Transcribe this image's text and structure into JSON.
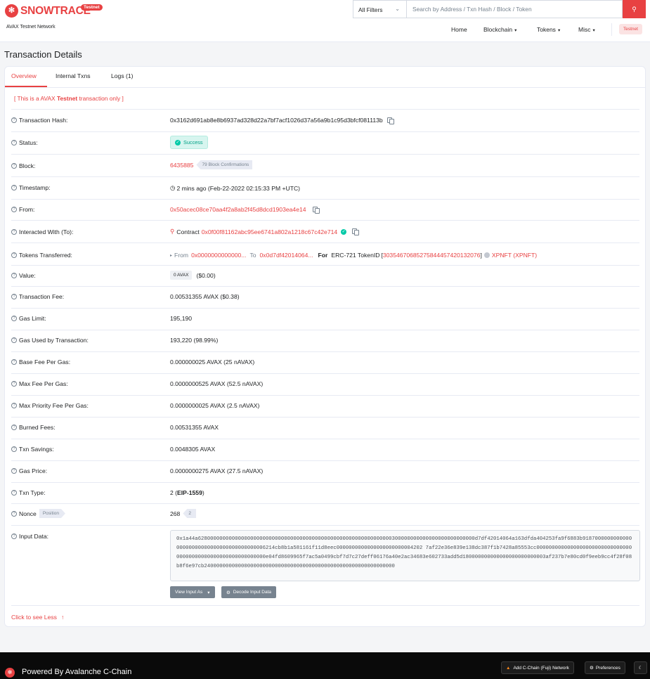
{
  "header": {
    "logo_text": "SNOWTRACE",
    "logo_badge": "Testnet",
    "network_label": "AVAX Testnet Network",
    "filter_value": "All Filters",
    "search_placeholder": "Search by Address / Txn Hash / Block / Token",
    "nav": {
      "home": "Home",
      "blockchain": "Blockchain",
      "tokens": "Tokens",
      "misc": "Misc",
      "badge": "Testnet"
    }
  },
  "page_title": "Transaction Details",
  "tabs": [
    "Overview",
    "Internal Txns",
    "Logs (1)"
  ],
  "notice": {
    "open": "[ This is a AVAX ",
    "bold": "Testnet",
    "close": " transaction only ]"
  },
  "fields": {
    "tx_hash": {
      "label": "Transaction Hash:",
      "value": "0x3162d691ab8e8b6937ad328d22a7bf7acf1026d37a56a9b1c95d3bfcf081113b"
    },
    "status": {
      "label": "Status:",
      "value": "Success"
    },
    "block": {
      "label": "Block:",
      "value": "6435885",
      "confirmations": "79 Block Confirmations"
    },
    "timestamp": {
      "label": "Timestamp:",
      "value": "2 mins ago (Feb-22-2022 02:15:33 PM +UTC)"
    },
    "from": {
      "label": "From:",
      "value": "0x50acec08ce70aa4f2a8ab2f45d8dcd1903ea4e14"
    },
    "interacted": {
      "label": "Interacted With (To):",
      "prefix": "Contract",
      "value": "0x0f00f81162abc95ee6741a802a1218c67c42e714"
    },
    "tokens": {
      "label": "Tokens Transferred:",
      "from_label": "From",
      "from_value": "0x0000000000000...",
      "to_label": "To",
      "to_value": "0x0d7df42014064...",
      "for_label": "For",
      "standard": "ERC-721 TokenID",
      "token_id": "30354670685275844457420132076",
      "token_name": "XPNFT (XPNFT)"
    },
    "value": {
      "label": "Value:",
      "chip": "0 AVAX",
      "usd": "($0.00)"
    },
    "txn_fee": {
      "label": "Transaction Fee:",
      "value": "0.00531355 AVAX ($0.38)"
    },
    "gas_limit": {
      "label": "Gas Limit:",
      "value": "195,190"
    },
    "gas_used": {
      "label": "Gas Used by Transaction:",
      "value": "193,220 (98.99%)"
    },
    "base_fee": {
      "label": "Base Fee Per Gas:",
      "value": "0.000000025 AVAX (25 nAVAX)"
    },
    "max_fee": {
      "label": "Max Fee Per Gas:",
      "value": "0.0000000525 AVAX (52.5 nAVAX)"
    },
    "max_priority": {
      "label": "Max Priority Fee Per Gas:",
      "value": "0.0000000025 AVAX (2.5 nAVAX)"
    },
    "burned": {
      "label": "Burned Fees:",
      "value": "0.00531355 AVAX"
    },
    "savings": {
      "label": "Txn Savings:",
      "value": "0.0048305 AVAX"
    },
    "gas_price": {
      "label": "Gas Price:",
      "value": "0.0000000275 AVAX (27.5 nAVAX)"
    },
    "txn_type": {
      "label": "Txn Type:",
      "value": "2",
      "type_name": "EIP-1559"
    },
    "nonce": {
      "label": "Nonce",
      "position_badge": "Position",
      "value": "268",
      "position": "2"
    },
    "input_data": {
      "label": "Input Data:",
      "value": "0x1a44a628000000000000000000000000000000000000000000000000000000000000300000000000000000000000000d7df42014064a163dfda404253fa9f6883b918700000000000000000000000000000000000000006214cb8b1a581161f11d8eec0000000000000000000000004202 7af22e36e839e138dc387f1b7428a85553cc000000000000000000000000000000000000000000000000000000000000e04fd8609965f7ac5a0499cbf7d7c27deff06176a40e2ac34683e602733add5d180000000000000000000000003af237b7e80cd0f9eeb9cc4f28f08b8f6e97cb24000000000000000000000000000000000000000000000000000000000000",
      "view_button": "View Input As",
      "decode_button": "Decode Input Data"
    }
  },
  "click_less": "Click to see Less",
  "footer": {
    "text": "Powered By Avalanche C-Chain",
    "add_network": "Add C-Chain (Fuji) Network",
    "preferences": "Preferences"
  },
  "colors": {
    "accent": "#e84142",
    "success": "#00c9a7",
    "muted": "#77838f"
  }
}
